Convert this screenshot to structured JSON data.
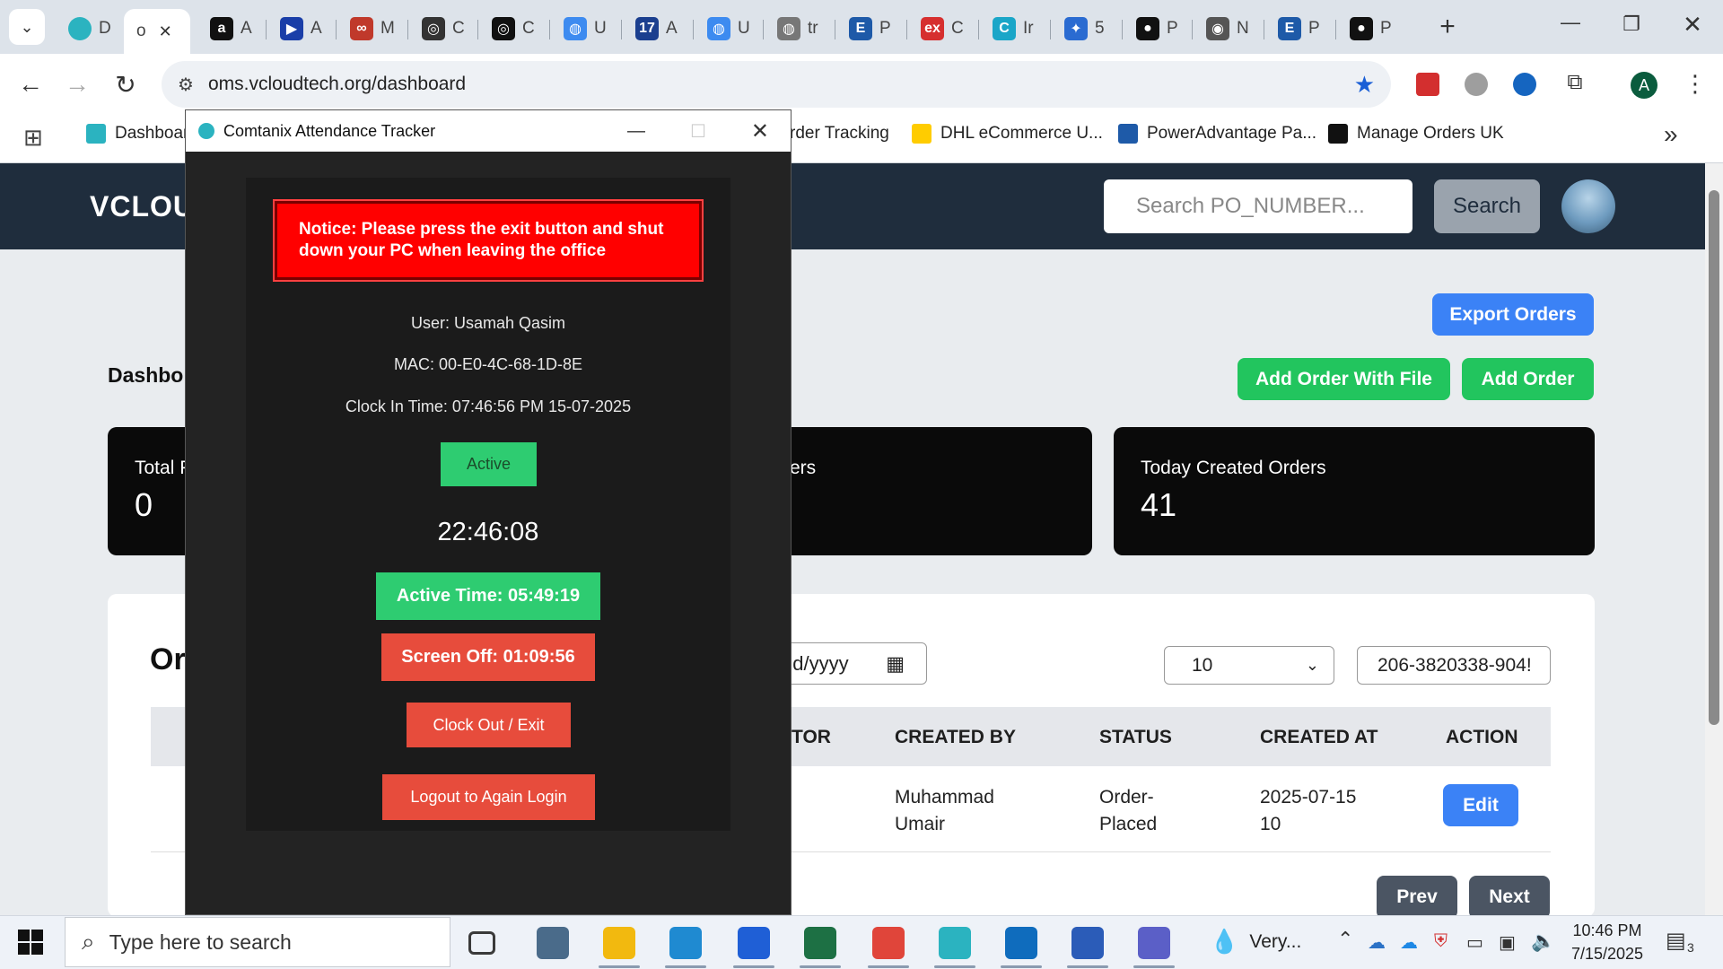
{
  "browser": {
    "tabs": [
      {
        "label": "D",
        "icon_color": "#2bb3c0",
        "icon": "hexagon-icon"
      },
      {
        "label": "o",
        "icon_color": "#ffffff",
        "icon": "",
        "active": true
      },
      {
        "label": "A",
        "icon_color": "#111111",
        "icon": "amazon-icon",
        "glyph": "a"
      },
      {
        "label": "A",
        "icon_color": "#1a3ea8",
        "icon": "arrow-icon",
        "glyph": "▶"
      },
      {
        "label": "M",
        "icon_color": "#c0392b",
        "icon": "people-icon",
        "glyph": "∞"
      },
      {
        "label": "C",
        "icon_color": "#333333",
        "icon": "openai-icon",
        "glyph": "◎"
      },
      {
        "label": "C",
        "icon_color": "#111111",
        "icon": "openai-icon",
        "glyph": "◎"
      },
      {
        "label": "U",
        "icon_color": "#3d8bf0",
        "icon": "globe-icon",
        "glyph": "◍"
      },
      {
        "label": "A",
        "icon_color": "#1b3f8f",
        "icon": "17track-icon",
        "glyph": "17"
      },
      {
        "label": "U",
        "icon_color": "#3d8bf0",
        "icon": "globe-icon",
        "glyph": "◍"
      },
      {
        "label": "tr",
        "icon_color": "#777777",
        "icon": "globe-icon",
        "glyph": "◍"
      },
      {
        "label": "P",
        "icon_color": "#1e5aa8",
        "icon": "e-icon",
        "glyph": "E"
      },
      {
        "label": "C",
        "icon_color": "#d62f2f",
        "icon": "ex-icon",
        "glyph": "ex"
      },
      {
        "label": "Ir",
        "icon_color": "#1aa6c8",
        "icon": "c-icon",
        "glyph": "C"
      },
      {
        "label": "5",
        "icon_color": "#2a6bd1",
        "icon": "puzzle-icon",
        "glyph": "✦"
      },
      {
        "label": "P",
        "icon_color": "#111111",
        "icon": "face-icon",
        "glyph": "●"
      },
      {
        "label": "N",
        "icon_color": "#555555",
        "icon": "chrome-icon",
        "glyph": "◉"
      },
      {
        "label": "P",
        "icon_color": "#1e5aa8",
        "icon": "e-icon",
        "glyph": "E"
      },
      {
        "label": "P",
        "icon_color": "#111111",
        "icon": "face-icon",
        "glyph": "●"
      }
    ],
    "url": "oms.vcloudtech.org/dashboard",
    "profile_initial": "A",
    "bookmarks": [
      {
        "label": "Dashboar",
        "color": "#2bb3c0"
      },
      {
        "label": "rder Tracking",
        "color": ""
      },
      {
        "label": "DHL eCommerce U...",
        "color": "#ffcc00"
      },
      {
        "label": "PowerAdvantage Pa...",
        "color": "#1e5aa8"
      },
      {
        "label": "Manage Orders UK",
        "color": "#111111"
      }
    ]
  },
  "app": {
    "logo_text": "VCLOU",
    "search_placeholder": "Search PO_NUMBER...",
    "search_button": "Search",
    "export_button": "Export Orders",
    "add_with_file_button": "Add Order With File",
    "add_order_button": "Add Order",
    "page_title": "Dashbo",
    "cards": [
      {
        "title": "Total P",
        "value": "0"
      },
      {
        "title": "ers",
        "value": ""
      },
      {
        "title": "Today Created Orders",
        "value": "41"
      }
    ],
    "orders_title": "Or",
    "date_placeholder": "dd/yyyy",
    "page_size": "10",
    "search_value": "206-3820338-904!",
    "table": {
      "headers": [
        "TOR",
        "CREATED BY",
        "STATUS",
        "CREATED AT",
        "ACTION"
      ],
      "rows": [
        {
          "created_by": [
            "Muhammad",
            "Umair"
          ],
          "status": [
            "Order-",
            "Placed"
          ],
          "created_at": [
            "2025-07-15",
            "10"
          ],
          "action": "Edit"
        }
      ]
    },
    "prev_button": "Prev",
    "next_button": "Next",
    "colors": {
      "green": "#22c55e",
      "blue": "#3b82f6",
      "header": "#1f2d3d",
      "gray_btn": "#4b5563"
    }
  },
  "dialog": {
    "title": "Comtanix Attendance Tracker",
    "notice": "Notice: Please press the exit button and shut down your PC when leaving the office",
    "user": "User: Usamah Qasim",
    "mac": "MAC: 00-E0-4C-68-1D-8E",
    "clock_in": "Clock In Time: 07:46:56 PM 15-07-2025",
    "status": "Active",
    "clock": "22:46:08",
    "active_time": "Active Time: 05:49:19",
    "screen_off": "Screen Off: 01:09:56",
    "clock_out": "Clock Out / Exit",
    "logout": "Logout to Again Login"
  },
  "taskbar": {
    "search_placeholder": "Type here to search",
    "weather": "Very...",
    "time": "10:46 PM",
    "date": "7/15/2025",
    "notifications": "3",
    "apps": [
      {
        "name": "task-view-icon",
        "color": "#3a3a3a"
      },
      {
        "name": "calculator-icon",
        "color": "#4a6b8a"
      },
      {
        "name": "file-explorer-icon",
        "color": "#f2b90f"
      },
      {
        "name": "edge-icon",
        "color": "#1f8ad1"
      },
      {
        "name": "zoho-icon",
        "color": "#1f5fd6"
      },
      {
        "name": "excel-icon",
        "color": "#1d7044"
      },
      {
        "name": "chrome-icon",
        "color": "#e0453a"
      },
      {
        "name": "comtanix-icon",
        "color": "#2bb3c0"
      },
      {
        "name": "outlook-icon",
        "color": "#0f6cbd"
      },
      {
        "name": "word-icon",
        "color": "#2b5cb8"
      },
      {
        "name": "teams-icon",
        "color": "#5b5fc7"
      }
    ]
  }
}
